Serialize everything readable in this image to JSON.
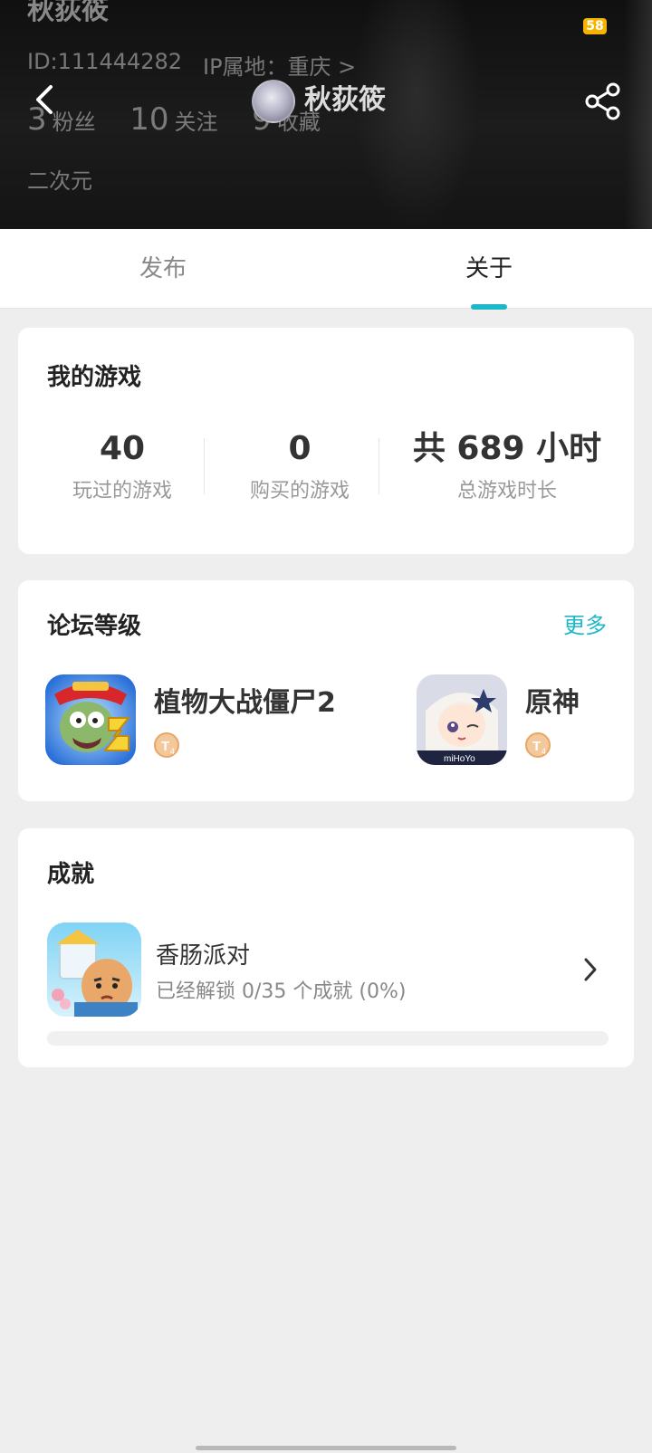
{
  "header": {
    "background_name": "秋荻筱",
    "user_id": "ID:111444282",
    "ip_location": "IP属地：重庆 >",
    "counts": [
      {
        "num": "3",
        "label": "粉丝"
      },
      {
        "num": "10",
        "label": "关注"
      },
      {
        "num": "9",
        "label": "收藏"
      }
    ],
    "tag": "二次元",
    "title_name": "秋荻筱",
    "battery": "58"
  },
  "tabs": [
    {
      "label": "发布",
      "selected": false
    },
    {
      "label": "关于",
      "selected": true
    }
  ],
  "games_card": {
    "title": "我的游戏",
    "stats": [
      {
        "value": "40",
        "label": "玩过的游戏"
      },
      {
        "value": "0",
        "label": "购买的游戏"
      },
      {
        "value": "共 689 小时",
        "label": "总游戏时长"
      }
    ]
  },
  "forum_card": {
    "title": "论坛等级",
    "more_label": "更多",
    "items": [
      {
        "name": "植物大战僵尸2",
        "icon": "pvz2-app-icon",
        "level_icon": "level-badge-icon"
      },
      {
        "name": "原神",
        "icon": "genshin-app-icon",
        "level_icon": "level-badge-icon"
      }
    ]
  },
  "achievements_card": {
    "title": "成就",
    "item": {
      "name": "香肠派对",
      "progress_text": "已经解锁 0/35 个成就 (0%)",
      "progress_fraction": 0
    }
  },
  "colors": {
    "accent": "#1eb8c8",
    "badge": "#f5b400"
  }
}
